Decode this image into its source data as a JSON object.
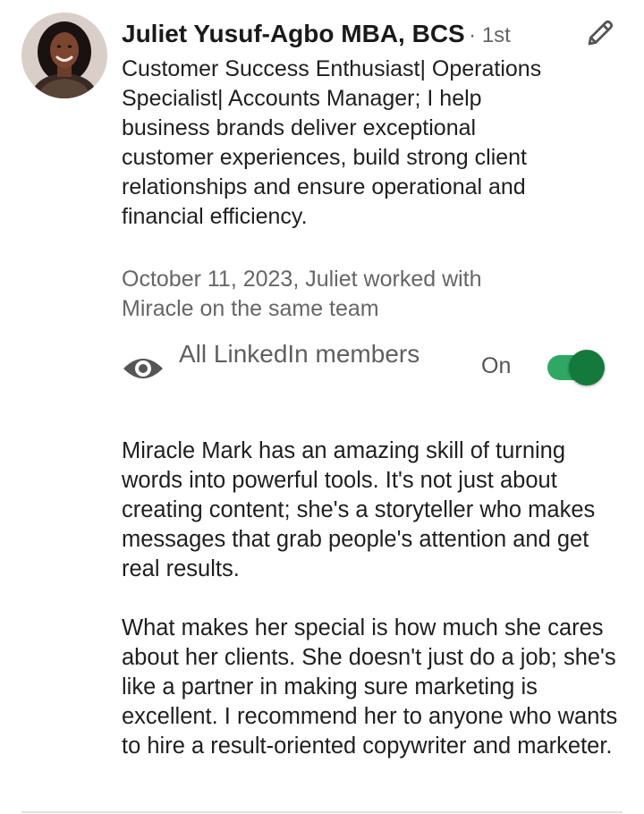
{
  "author": {
    "name": "Juliet Yusuf-Agbo MBA, BCS",
    "connection_degree": "· 1st",
    "headline": "Customer Success Enthusiast| Operations Specialist| Accounts Manager; I help business brands deliver exceptional customer experiences, build strong client relationships and ensure operational and financial efficiency.",
    "avatar_icon": "profile-photo"
  },
  "edit": {
    "icon": "pencil-icon"
  },
  "recommendation_context": "October 11, 2023, Juliet worked with Miracle on the same team",
  "visibility": {
    "icon": "eye-icon",
    "label": "All LinkedIn members",
    "status": "On",
    "enabled": true
  },
  "recommendation_text": {
    "paragraph_1": "Miracle Mark has an amazing skill of turning words into powerful tools. It's not just about creating content; she's a storyteller who makes messages that grab people's attention and get real results.",
    "paragraph_2": "What makes her special is how much she cares about her clients. She doesn't just do a job; she's like a partner in making sure marketing is excellent. I recommend her to anyone who wants to hire a result-oriented copywriter and marketer."
  },
  "colors": {
    "toggle_track": "#2ea863",
    "toggle_knob": "#137a3c",
    "secondary_text": "#666666"
  }
}
